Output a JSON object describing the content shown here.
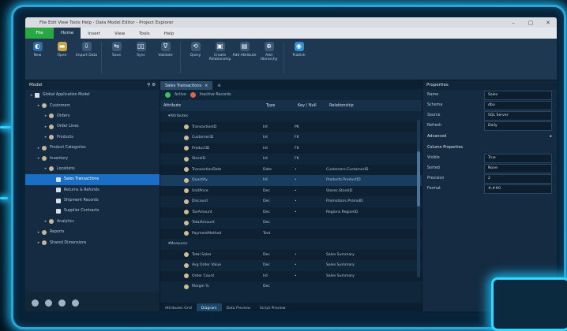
{
  "window": {
    "title": "File Edit View Tools Help · Data Model Editor - Project Explorer",
    "controls": [
      "–",
      "▢",
      "✕"
    ]
  },
  "ribbon_tabs": {
    "file": "File",
    "items": [
      "Home",
      "Insert",
      "View",
      "Tools",
      "Help"
    ],
    "active": 0
  },
  "ribbon": {
    "buttons": [
      {
        "label": "New",
        "icon": "new-icon",
        "color": "#2d6ca3",
        "glyph": "◐"
      },
      {
        "label": "Open",
        "icon": "open-folder-icon",
        "color": "#caa64a",
        "glyph": "▬"
      },
      {
        "label": "Import Data",
        "icon": "import-icon",
        "color": "#3a5a78",
        "glyph": "⇩"
      },
      {
        "label": "Save",
        "icon": "save-icon",
        "color": "#3a5a78",
        "glyph": "⇆"
      },
      {
        "label": "Sync",
        "icon": "sync-icon",
        "color": "#3a5a78",
        "glyph": "▯▯"
      },
      {
        "label": "Validate",
        "icon": "validate-icon",
        "color": "#3a5a78",
        "glyph": "∇"
      },
      {
        "label": "Query",
        "icon": "query-icon",
        "color": "#3a5a78",
        "glyph": "⟲"
      },
      {
        "label": "Create Relationship",
        "icon": "relationship-icon",
        "color": "#3a5a78",
        "glyph": "▣"
      },
      {
        "label": "Add Attribute",
        "icon": "attribute-icon",
        "color": "#3a5a78",
        "glyph": "▤"
      },
      {
        "label": "Add Hierarchy",
        "icon": "hierarchy-icon",
        "color": "#3a5a78",
        "glyph": "⊕"
      },
      {
        "label": "Publish",
        "icon": "publish-icon",
        "color": "#2f8fd6",
        "glyph": "◉"
      }
    ]
  },
  "left": {
    "title": "Model",
    "tree": [
      {
        "label": "Global Application Model",
        "depth": 0,
        "icon": "doc"
      },
      {
        "label": "Customers",
        "depth": 1,
        "icon": "circle"
      },
      {
        "label": "Orders",
        "depth": 2,
        "icon": "circle"
      },
      {
        "label": "Order Lines",
        "depth": 2,
        "icon": "circle"
      },
      {
        "label": "Products",
        "depth": 2,
        "icon": "circle"
      },
      {
        "label": "Product Categories",
        "depth": 1,
        "icon": "circle"
      },
      {
        "label": "Inventory",
        "depth": 1,
        "icon": "circle"
      },
      {
        "label": "Locations",
        "depth": 2,
        "icon": "circle"
      },
      {
        "label": "Sales Transactions",
        "depth": 3,
        "icon": "doc",
        "selected": true
      },
      {
        "label": "Returns & Refunds",
        "depth": 3,
        "icon": "doc"
      },
      {
        "label": "Shipment Records",
        "depth": 3,
        "icon": "doc"
      },
      {
        "label": "Supplier Contracts",
        "depth": 3,
        "icon": "doc"
      },
      {
        "label": "Analytics",
        "depth": 2,
        "icon": "circle"
      },
      {
        "label": "Reports",
        "depth": 1,
        "icon": "circle"
      },
      {
        "label": "Shared Dimensions",
        "depth": 1,
        "icon": "circle"
      }
    ],
    "bottom_icons": [
      "settings-icon",
      "users-icon",
      "record-icon",
      "power-icon"
    ]
  },
  "center": {
    "tabs": [
      "Sales Transactions",
      "⊕"
    ],
    "filters": [
      "Active",
      "Inactive Records"
    ],
    "columns": [
      "Attribute",
      "Type",
      "Key / Null",
      "Relationship"
    ],
    "rows": [
      {
        "c1": "Attributes",
        "c2": "",
        "c3": "",
        "c4": "",
        "header": true
      },
      {
        "c1": "TransactionID",
        "c2": "Int",
        "c3": "PK",
        "c4": ""
      },
      {
        "c1": "CustomerID",
        "c2": "Int",
        "c3": "FK",
        "c4": ""
      },
      {
        "c1": "ProductID",
        "c2": "Int",
        "c3": "FK",
        "c4": ""
      },
      {
        "c1": "StoreID",
        "c2": "Int",
        "c3": "FK",
        "c4": ""
      },
      {
        "c1": "TransactionDate",
        "c2": "Date",
        "c3": "•",
        "c4": "Customers.CustomerID"
      },
      {
        "c1": "Quantity",
        "c2": "Int",
        "c3": "•",
        "c4": "Products.ProductID",
        "hl": true
      },
      {
        "c1": "UnitPrice",
        "c2": "Dec",
        "c3": "•",
        "c4": "Stores.StoreID"
      },
      {
        "c1": "Discount",
        "c2": "Dec",
        "c3": "•",
        "c4": "Promotions.PromoID"
      },
      {
        "c1": "TaxAmount",
        "c2": "Dec",
        "c3": "•",
        "c4": "Regions.RegionID"
      },
      {
        "c1": "TotalAmount",
        "c2": "Dec",
        "c3": "",
        "c4": ""
      },
      {
        "c1": "PaymentMethod",
        "c2": "Text",
        "c3": "",
        "c4": ""
      },
      {
        "c1": "Measures",
        "c2": "",
        "c3": "",
        "c4": "",
        "header": true
      },
      {
        "c1": "Total Sales",
        "c2": "Dec",
        "c3": "•",
        "c4": "Sales Summary"
      },
      {
        "c1": "Avg Order Value",
        "c2": "Dec",
        "c3": "•",
        "c4": "Sales Summary"
      },
      {
        "c1": "Order Count",
        "c2": "Int",
        "c3": "•",
        "c4": "Sales Summary"
      },
      {
        "c1": "Margin %",
        "c2": "Dec",
        "c3": "",
        "c4": ""
      }
    ],
    "bottom_tabs": [
      "Attributes Grid",
      "Diagram",
      "Data Preview",
      "Script Preview"
    ],
    "bottom_active": 1
  },
  "right": {
    "title": "Properties",
    "props": [
      {
        "k": "Name",
        "v": "Sales"
      },
      {
        "k": "Schema",
        "v": "dbo"
      },
      {
        "k": "Source",
        "v": "SQL Server"
      },
      {
        "k": "Refresh",
        "v": "Daily"
      }
    ],
    "section1": "Advanced",
    "section2": "Column Properties",
    "props2": [
      {
        "k": "Visible",
        "v": "True"
      },
      {
        "k": "Sorted",
        "v": "None"
      },
      {
        "k": "Precision",
        "v": "2"
      },
      {
        "k": "Format",
        "v": "#,##0"
      }
    ]
  }
}
